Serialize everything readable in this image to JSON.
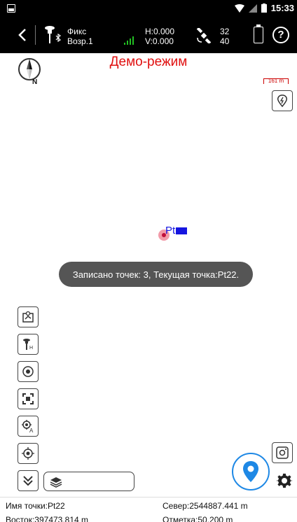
{
  "statusbar": {
    "time": "15:33"
  },
  "toolbar": {
    "status_line1": "Фикс",
    "status_line2": "Возр.1",
    "h_value": "H:0.000",
    "v_value": "V:0.000",
    "sat_used": "32",
    "sat_visible": "40"
  },
  "map": {
    "demo_label": "Демо-режим",
    "scale_label": "161 m",
    "point_label": "Pt",
    "toast": "Записано точек: 3, Текущая точка:Pt22."
  },
  "info": {
    "point_name": "Имя точки:Pt22",
    "north": "Север:2544887.441 m",
    "east": "Восток:397473.814 m",
    "elevation": "Отметка:50.200 m"
  },
  "colors": {
    "accent": "#1e88e5",
    "demo": "#e01010",
    "signal": "#22c022"
  }
}
